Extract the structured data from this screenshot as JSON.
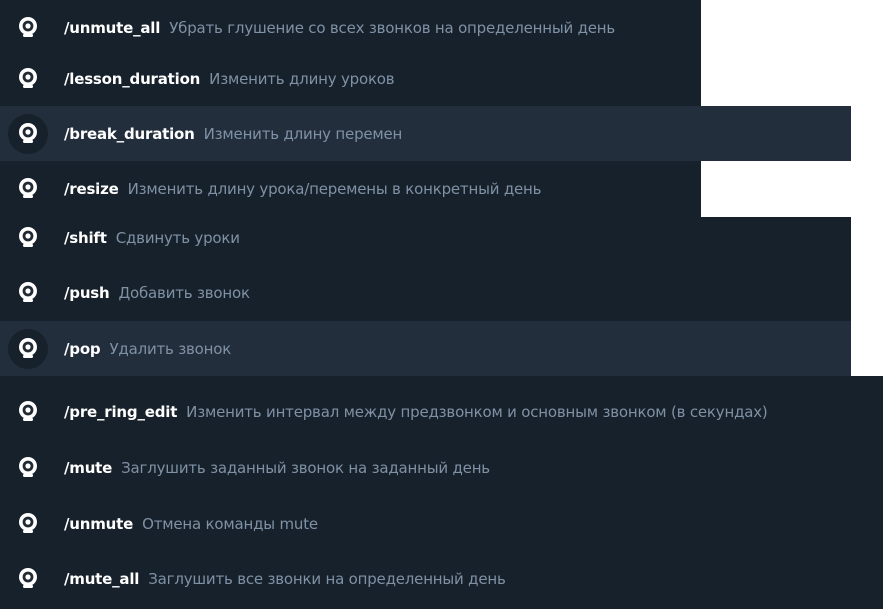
{
  "commands": [
    {
      "command": "/unmute_all",
      "description": "Убрать глушение со всех звонков на определенный день",
      "selected": false
    },
    {
      "command": "/lesson_duration",
      "description": "Изменить длину уроков",
      "selected": false
    },
    {
      "command": "/break_duration",
      "description": "Изменить длину перемен",
      "selected": true
    },
    {
      "command": "/resize",
      "description": "Изменить длину урока/перемены в конкретный день",
      "selected": false
    },
    {
      "command": "/shift",
      "description": "Сдвинуть уроки",
      "selected": false
    },
    {
      "command": "/push",
      "description": "Добавить звонок",
      "selected": false
    },
    {
      "command": "/pop",
      "description": "Удалить звонок",
      "selected": true
    },
    {
      "command": "/pre_ring_edit",
      "description": "Изменить интервал между предзвонком и основным звонком (в секундах)",
      "selected": false
    },
    {
      "command": "/mute",
      "description": "Заглушить заданный звонок на заданный день",
      "selected": false
    },
    {
      "command": "/unmute",
      "description": "Отмена команды mute",
      "selected": false
    },
    {
      "command": "/mute_all",
      "description": "Заглушить все звонки на определенный день",
      "selected": false
    }
  ],
  "bot_avatar_icon": "bell-icon"
}
